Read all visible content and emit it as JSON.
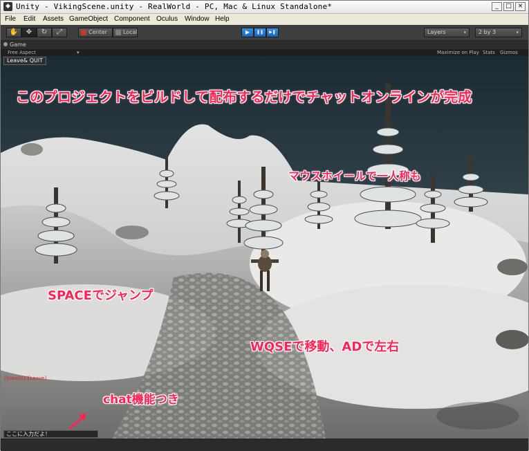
{
  "window": {
    "title": "Unity - VikingScene.unity - RealWorld - PC, Mac & Linux Standalone*",
    "minimize": "_",
    "maximize": "□",
    "close": "×"
  },
  "menu": [
    "File",
    "Edit",
    "Assets",
    "GameObject",
    "Component",
    "Oculus",
    "Window",
    "Help"
  ],
  "toolbar": {
    "tools": [
      "hand-icon",
      "move-icon",
      "rotate-icon",
      "scale-icon"
    ],
    "pivot": "Center",
    "space": "Local",
    "play": "▶",
    "pause": "❚❚",
    "step": "▶❚",
    "layers": "Layers",
    "layout": "2 by 3"
  },
  "game_panel": {
    "tab": "Game",
    "aspect": "Free Aspect",
    "maximize_on_play": "Maximize on Play",
    "stats": "Stats",
    "gizmos": "Gizmos"
  },
  "overlay": {
    "leave_button": "Leave& QUIT",
    "log_line": "[Sopel](1)[Leave]",
    "chat_placeholder": "ここに入力だよ！"
  },
  "annotations": {
    "headline": "このプロジェクトをビルドして配布するだけでチャットオンラインが完成",
    "mouse_wheel": "マウスホイールで一人称も",
    "space_jump": "SPACEでジャンプ",
    "movement": "WQSEで移動、ADで左右",
    "chat": "chat機能つき"
  },
  "colors": {
    "annotation": "#ff2255",
    "play_blue": "#2a7bd4",
    "editor_dark": "#3e3e3e"
  }
}
